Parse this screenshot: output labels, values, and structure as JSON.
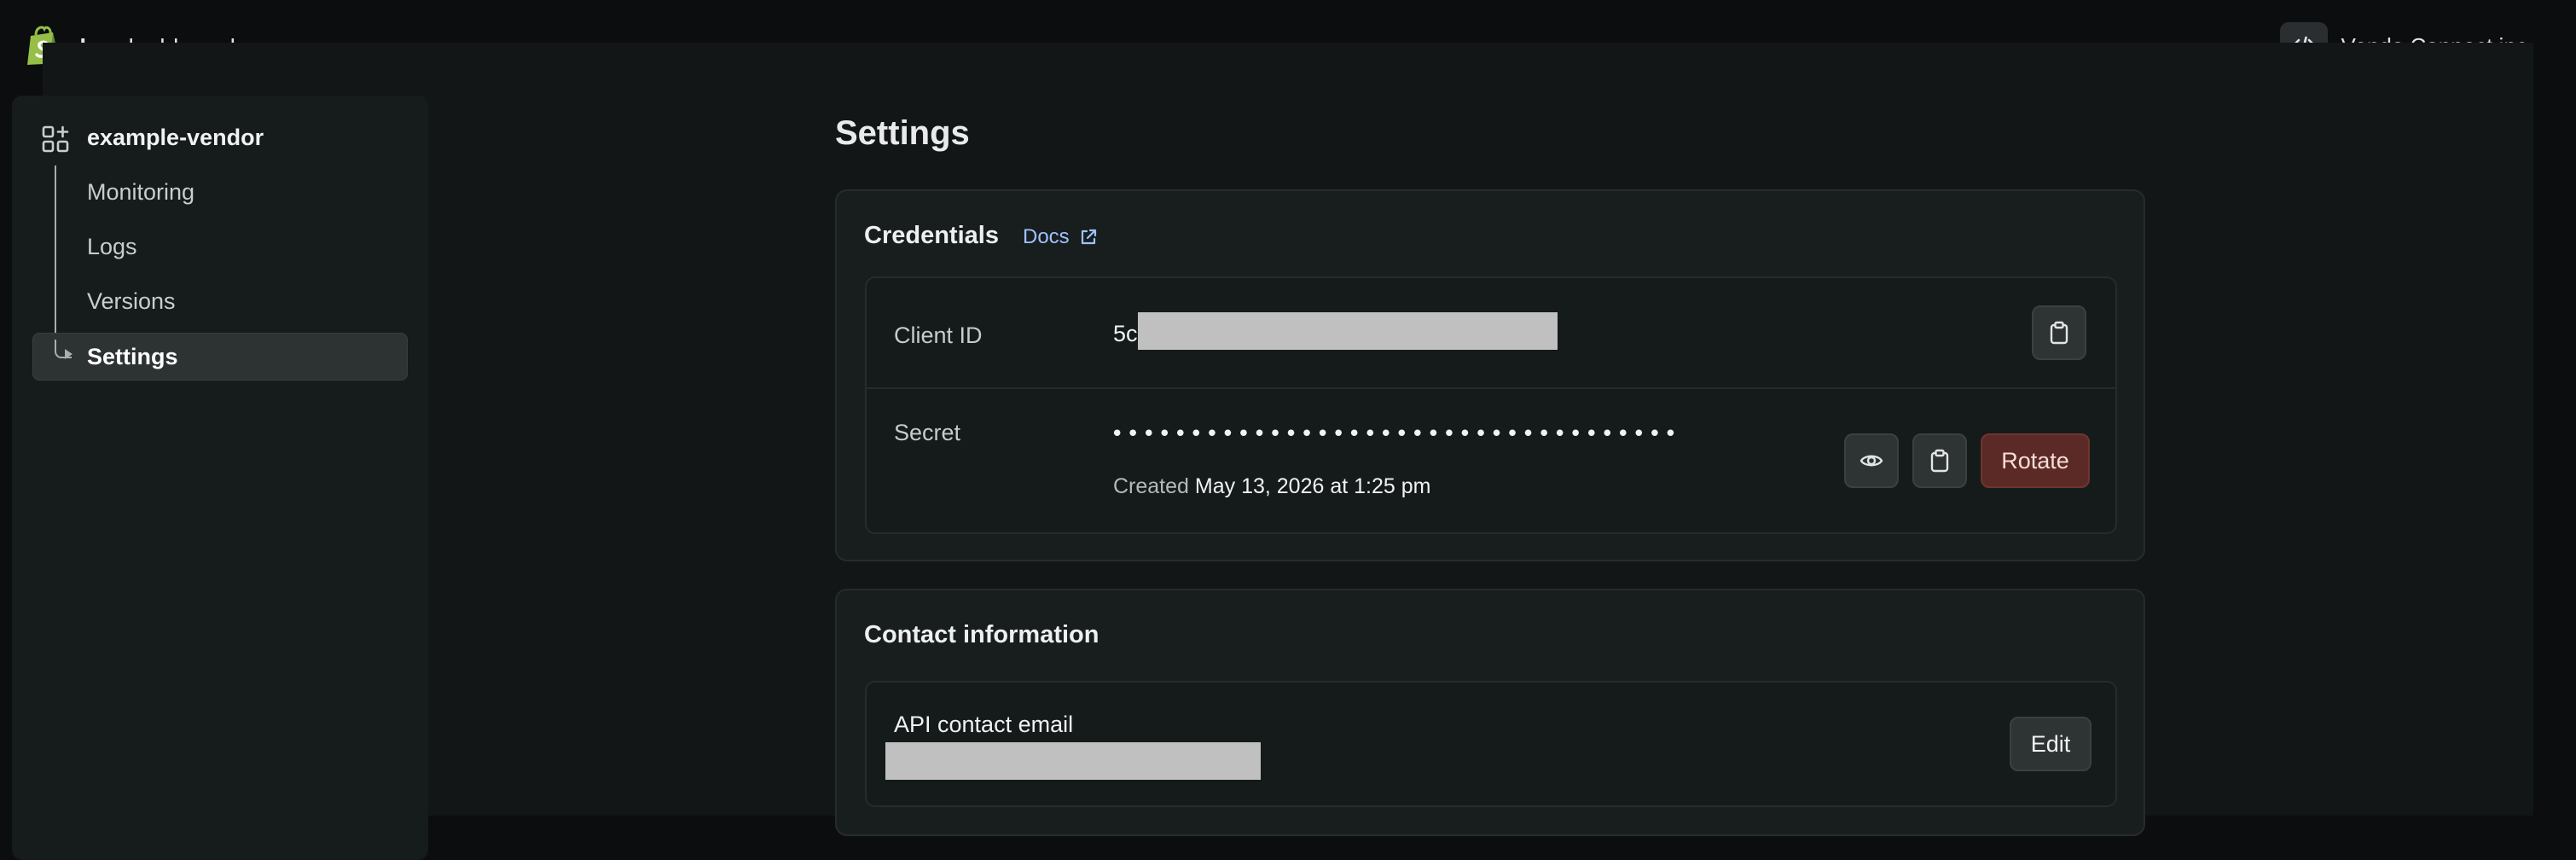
{
  "header": {
    "brand_bold": "dev",
    "brand_rest": "dashboard",
    "org_name": "Vendo Connect inc.",
    "icons": {
      "logo": "shopify-bag-icon",
      "org": "code-brackets-icon"
    }
  },
  "sidebar": {
    "app_name": "example-vendor",
    "items": [
      {
        "label": "Monitoring",
        "active": false
      },
      {
        "label": "Logs",
        "active": false
      },
      {
        "label": "Versions",
        "active": false
      },
      {
        "label": "Settings",
        "active": true
      }
    ]
  },
  "main": {
    "title": "Settings",
    "credentials": {
      "title": "Credentials",
      "docs_label": "Docs",
      "client_id_label": "Client ID",
      "client_id_visible": "5c",
      "secret_label": "Secret",
      "secret_masked": "••••••••••••••••••••••••••••••••••••",
      "created_prefix": "Created",
      "created_date": "May 13, 2026 at 1:25 pm",
      "rotate_label": "Rotate"
    },
    "contact": {
      "title": "Contact information",
      "email_label": "API contact email",
      "edit_label": "Edit"
    }
  },
  "colors": {
    "background": "#0b0d0e",
    "card": "#181d1d",
    "link": "#9ec2ff",
    "danger": "#5b2a26",
    "logo_green": "#95bf47"
  }
}
